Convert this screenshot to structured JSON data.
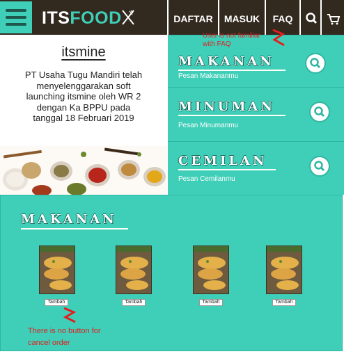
{
  "header": {
    "logo_its": "ITS",
    "logo_food": "FOOD",
    "nav": [
      "DAFTAR",
      "MASUK",
      "FAQ"
    ]
  },
  "info": {
    "brand": "itsmine",
    "description": "PT Usaha Tugu Mandiri telah menyelenggarakan soft launching itsmine oleh WR 2 dengan Ka BPPU pada tanggal 18 Februari 2019"
  },
  "categories": [
    {
      "title": "MAKANAN",
      "subtitle": "Pesan Makananmu"
    },
    {
      "title": "MINUMAN",
      "subtitle": "Pesan Minumanmu"
    },
    {
      "title": "CEMILAN",
      "subtitle": "Pesan Cemilanmu"
    }
  ],
  "section": {
    "title": "MAKANAN",
    "items": [
      {
        "button": "Tambah"
      },
      {
        "button": "Tambah"
      },
      {
        "button": "Tambah"
      },
      {
        "button": "Tambah"
      }
    ]
  },
  "annotations": {
    "faq_note": "User is not familiar with FAQ",
    "cancel_note": "There is no button for cancel order"
  },
  "colors": {
    "header_bg": "#32291f",
    "accent_teal": "#3fcfb8",
    "annotation_red": "#e02020"
  },
  "icons": [
    "menu-icon",
    "fork-knife-icon",
    "search-icon",
    "cart-icon"
  ]
}
